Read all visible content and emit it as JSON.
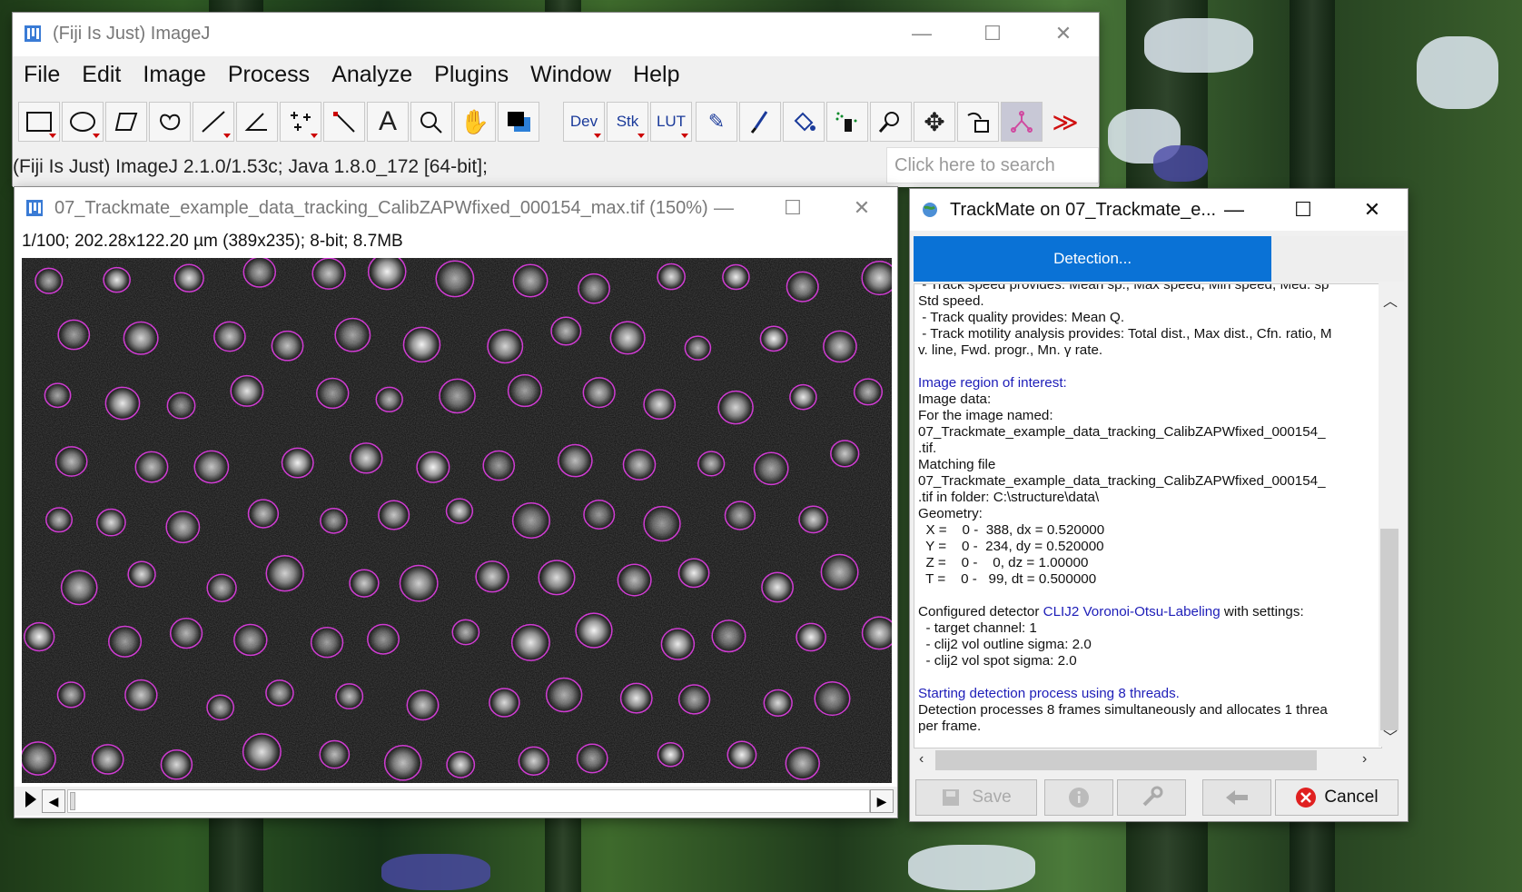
{
  "main_window": {
    "title": "(Fiji Is Just) ImageJ",
    "menu": [
      "File",
      "Edit",
      "Image",
      "Process",
      "Analyze",
      "Plugins",
      "Window",
      "Help"
    ],
    "toolbar": {
      "tools": [
        "rectangle",
        "oval",
        "polygon",
        "freehand",
        "line",
        "angle",
        "multipoint",
        "wand",
        "text",
        "magnifier",
        "hand",
        "color-picker"
      ],
      "labeled_tools": [
        "Dev",
        "Stk",
        "LUT"
      ],
      "more_tools_glyph": "≫"
    },
    "status": "(Fiji Is Just) ImageJ 2.1.0/1.53c; Java 1.8.0_172 [64-bit];",
    "search_placeholder": "Click here to search"
  },
  "image_window": {
    "title": "07_Trackmate_example_data_tracking_CalibZAPWfixed_000154_max.tif (150%)",
    "info": "1/100; 202.28x122.20 µm (389x235); 8-bit; 8.7MB"
  },
  "trackmate": {
    "title": "TrackMate on 07_Trackmate_e...",
    "progress_label": "Detection...",
    "progress_fraction": 0.73,
    "log_lines": [
      {
        "t": " - Track speed provides: Mean sp., Max speed, Min speed, Med. sp",
        "c": ""
      },
      {
        "t": "Std speed.",
        "c": ""
      },
      {
        "t": " - Track quality provides: Mean Q.",
        "c": ""
      },
      {
        "t": " - Track motility analysis provides: Total dist., Max dist., Cfn. ratio, M",
        "c": ""
      },
      {
        "t": "v. line, Fwd. progr., Mn. γ rate.",
        "c": ""
      },
      {
        "t": "",
        "c": ""
      },
      {
        "t": "Image region of interest:",
        "c": "blue"
      },
      {
        "t": "Image data:",
        "c": ""
      },
      {
        "t": "For the image named:",
        "c": ""
      },
      {
        "t": "07_Trackmate_example_data_tracking_CalibZAPWfixed_000154_",
        "c": ""
      },
      {
        "t": ".tif.",
        "c": ""
      },
      {
        "t": "Matching file",
        "c": ""
      },
      {
        "t": "07_Trackmate_example_data_tracking_CalibZAPWfixed_000154_",
        "c": ""
      },
      {
        "t": ".tif in folder: C:\\structure\\data\\",
        "c": ""
      },
      {
        "t": "Geometry:",
        "c": ""
      },
      {
        "t": "  X =    0 -  388, dx = 0.520000",
        "c": ""
      },
      {
        "t": "  Y =    0 -  234, dy = 0.520000",
        "c": ""
      },
      {
        "t": "  Z =    0 -    0, dz = 1.00000",
        "c": ""
      },
      {
        "t": "  T =    0 -   99, dt = 0.500000",
        "c": ""
      },
      {
        "t": "",
        "c": ""
      },
      {
        "t": "Configured detector CLIJ2 Voronoi-Otsu-Labeling with settings:",
        "c": "mixed"
      },
      {
        "t": "  - target channel: 1",
        "c": ""
      },
      {
        "t": "  - clij2 vol outline sigma: 2.0",
        "c": ""
      },
      {
        "t": "  - clij2 vol spot sigma: 2.0",
        "c": ""
      },
      {
        "t": "",
        "c": ""
      },
      {
        "t": "Starting detection process using 8 threads.",
        "c": "blue"
      },
      {
        "t": "Detection processes 8 frames simultaneously and allocates 1 threa",
        "c": ""
      },
      {
        "t": "per frame.",
        "c": ""
      }
    ],
    "detector_name": "CLIJ2 Voronoi-Otsu-Labeling",
    "buttons": {
      "save": "Save",
      "cancel": "Cancel"
    }
  },
  "colors": {
    "accent": "#0a72d6",
    "roi_outline": "#d03cd3",
    "log_blue": "#1d1db8",
    "cancel_red": "#e02020"
  }
}
